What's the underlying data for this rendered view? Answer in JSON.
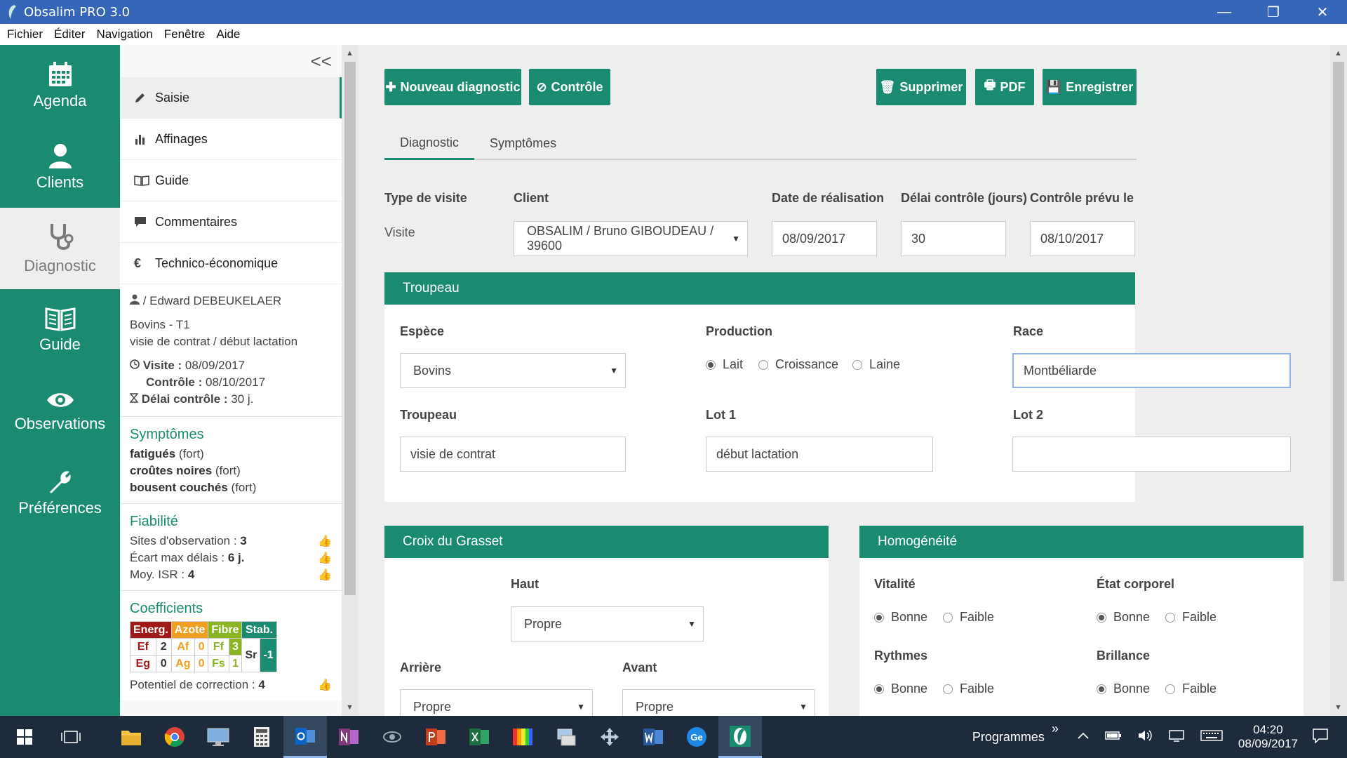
{
  "app": {
    "title": "Obsalim PRO 3.0"
  },
  "window_controls": {
    "minimize": "—",
    "restore": "❐",
    "close": "✕"
  },
  "menu": [
    "Fichier",
    "Éditer",
    "Navigation",
    "Fenêtre",
    "Aide"
  ],
  "nav": [
    {
      "label": "Agenda",
      "icon": "calendar-icon"
    },
    {
      "label": "Clients",
      "icon": "user-icon"
    },
    {
      "label": "Diagnostic",
      "icon": "stethoscope-icon"
    },
    {
      "label": "Guide",
      "icon": "book-icon"
    },
    {
      "label": "Observations",
      "icon": "eye-icon"
    },
    {
      "label": "Préférences",
      "icon": "wrench-icon"
    }
  ],
  "sidebar": {
    "collapse": "<<",
    "menu": [
      {
        "label": "Saisie",
        "icon": "pencil-icon"
      },
      {
        "label": "Affinages",
        "icon": "bar-chart-icon"
      },
      {
        "label": "Guide",
        "icon": "book-icon"
      },
      {
        "label": "Commentaires",
        "icon": "comment-icon"
      },
      {
        "label": "Technico-économique",
        "icon": "euro-icon"
      }
    ],
    "client": "/ Edward DEBEUKELAER",
    "espece": "Bovins - T1",
    "desc": "visie de contrat / début lactation",
    "visite_label": "Visite :",
    "visite_value": "08/09/2017",
    "controle_label": "Contrôle :",
    "controle_value": "08/10/2017",
    "delai_label": "Délai contrôle :",
    "delai_value": "30 j.",
    "symptomes_title": "Symptômes",
    "symptomes": [
      {
        "name": "fatigués",
        "level": "(fort)"
      },
      {
        "name": "croûtes noires",
        "level": "(fort)"
      },
      {
        "name": "bousent couchés",
        "level": "(fort)"
      }
    ],
    "fiabilite_title": "Fiabilité",
    "fiabilite": [
      {
        "label": "Sites d'observation :",
        "value": "3"
      },
      {
        "label": "Écart max délais :",
        "value": "6 j."
      },
      {
        "label": "Moy. ISR :",
        "value": "4"
      }
    ],
    "coef_title": "Coefficients",
    "coef": {
      "h_energ": "Energ.",
      "h_azote": "Azote",
      "h_fibre": "Fibre",
      "h_stab": "Stab.",
      "ef_l": "Ef",
      "ef_v": "2",
      "af_l": "Af",
      "af_v": "0",
      "ff_l": "Ff",
      "ff_v": "3",
      "eg_l": "Eg",
      "eg_v": "0",
      "ag_l": "Ag",
      "ag_v": "0",
      "fs_l": "Fs",
      "fs_v": "1",
      "sr_l": "Sr",
      "sr_v": "-1"
    },
    "potentiel_label": "Potentiel de correction :",
    "potentiel_value": "4"
  },
  "toolbar": {
    "new": "Nouveau diagnostic",
    "controle": "Contrôle",
    "delete": "Supprimer",
    "pdf": "PDF",
    "save": "Enregistrer"
  },
  "tabs": [
    "Diagnostic",
    "Symptômes"
  ],
  "form": {
    "type_label": "Type de visite",
    "type_value": "Visite",
    "client_label": "Client",
    "client_value": "OBSALIM / Bruno GIBOUDEAU / 39600",
    "date_label": "Date de réalisation",
    "date_value": "08/09/2017",
    "delai_label": "Délai contrôle (jours)",
    "delai_value": "30",
    "prevu_label": "Contrôle prévu le",
    "prevu_value": "08/10/2017"
  },
  "troupeau": {
    "title": "Troupeau",
    "espece_label": "Espèce",
    "espece_value": "Bovins",
    "production_label": "Production",
    "production_options": [
      "Lait",
      "Croissance",
      "Laine"
    ],
    "production_selected": "Lait",
    "race_label": "Race",
    "race_value": "Montbéliarde",
    "troupeau_label": "Troupeau",
    "troupeau_value": "visie de contrat",
    "lot1_label": "Lot 1",
    "lot1_value": "début lactation",
    "lot2_label": "Lot 2",
    "lot2_value": ""
  },
  "croix": {
    "title": "Croix du Grasset",
    "haut_label": "Haut",
    "haut_value": "Propre",
    "arriere_label": "Arrière",
    "arriere_value": "Propre",
    "avant_label": "Avant",
    "avant_value": "Propre"
  },
  "homog": {
    "title": "Homogénéité",
    "vitalite_label": "Vitalité",
    "etat_label": "État corporel",
    "rythmes_label": "Rythmes",
    "brillance_label": "Brillance",
    "opt_bonne": "Bonne",
    "opt_faible": "Faible",
    "selected": "Bonne"
  },
  "taskbar": {
    "programmes": "Programmes",
    "chevron": "»",
    "time": "04:20",
    "date": "08/09/2017"
  },
  "colors": {
    "accent": "#1a8b70",
    "titlebar": "#3566b8",
    "taskbar": "#1d2b3d"
  }
}
